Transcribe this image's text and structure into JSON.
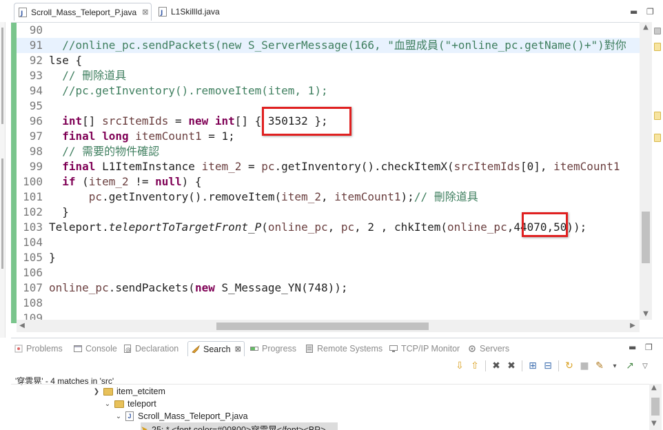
{
  "editor": {
    "tabs": [
      {
        "label": "Scroll_Mass_Teleport_P.java",
        "active": true,
        "close": "⊠"
      },
      {
        "label": "L1SkillId.java",
        "active": false
      }
    ],
    "lines": [
      {
        "num": "90",
        "text": ""
      },
      {
        "num": "91",
        "text": "  //online_pc.sendPackets(new S_ServerMessage(166, \"血盟成員(\"+online_pc.getName()+\")對你"
      },
      {
        "num": "92",
        "text": "lse {"
      },
      {
        "num": "93",
        "text": "  // 刪除道具"
      },
      {
        "num": "94",
        "text": "  //pc.getInventory().removeItem(item, 1);"
      },
      {
        "num": "95",
        "text": ""
      },
      {
        "num": "96",
        "text": "  int[] srcItemIds = new int[] { 350132 };"
      },
      {
        "num": "97",
        "text": "  final long itemCount1 = 1;"
      },
      {
        "num": "98",
        "text": "  // 需要的物件確認"
      },
      {
        "num": "99",
        "text": "  final L1ItemInstance item_2 = pc.getInventory().checkItemX(srcItemIds[0], itemCount1"
      },
      {
        "num": "100",
        "text": "  if (item_2 != null) {"
      },
      {
        "num": "101",
        "text": "      pc.getInventory().removeItem(item_2, itemCount1);// 刪除道具"
      },
      {
        "num": "102",
        "text": "  }"
      },
      {
        "num": "103",
        "text": "Teleport.teleportToTargetFront_P(online_pc, pc, 2 , chkItem(online_pc,44070,50));"
      },
      {
        "num": "104",
        "text": ""
      },
      {
        "num": "105",
        "text": "}"
      },
      {
        "num": "106",
        "text": ""
      },
      {
        "num": "107",
        "text": "online_pc.sendPackets(new S_Message_YN(748));"
      },
      {
        "num": "108",
        "text": ""
      },
      {
        "num": "109",
        "text": ""
      }
    ]
  },
  "bottom_panel": {
    "tabs": [
      {
        "label": "Problems",
        "icon": "problems-icon"
      },
      {
        "label": "Console",
        "icon": "console-icon"
      },
      {
        "label": "Declaration",
        "icon": "declaration-icon"
      },
      {
        "label": "Search",
        "icon": "search-icon",
        "active": true,
        "close": "⊠"
      },
      {
        "label": "Progress",
        "icon": "progress-icon"
      },
      {
        "label": "Remote Systems",
        "icon": "remote-systems-icon"
      },
      {
        "label": "TCP/IP Monitor",
        "icon": "tcpip-monitor-icon"
      },
      {
        "label": "Servers",
        "icon": "servers-icon"
      }
    ],
    "results_label": "'穿雲晃' - 4 matches in 'src'",
    "tree": [
      {
        "label": "item_etcitem",
        "type": "folder"
      },
      {
        "label": "teleport",
        "type": "folder"
      },
      {
        "label": "Scroll_Mass_Teleport_P.java",
        "type": "java-file"
      },
      {
        "label": "25: * <font color=#00800>穿雲晃</font><BR>",
        "type": "match"
      }
    ]
  },
  "colors": {
    "keyword": "#7f0055",
    "comment": "#3f7f5f",
    "string": "#2a00ff",
    "field": "#6a3e3e",
    "highlight_box": "#e02020",
    "change_ruler": "#7ac58c",
    "current_line": "#e8f2fe"
  }
}
